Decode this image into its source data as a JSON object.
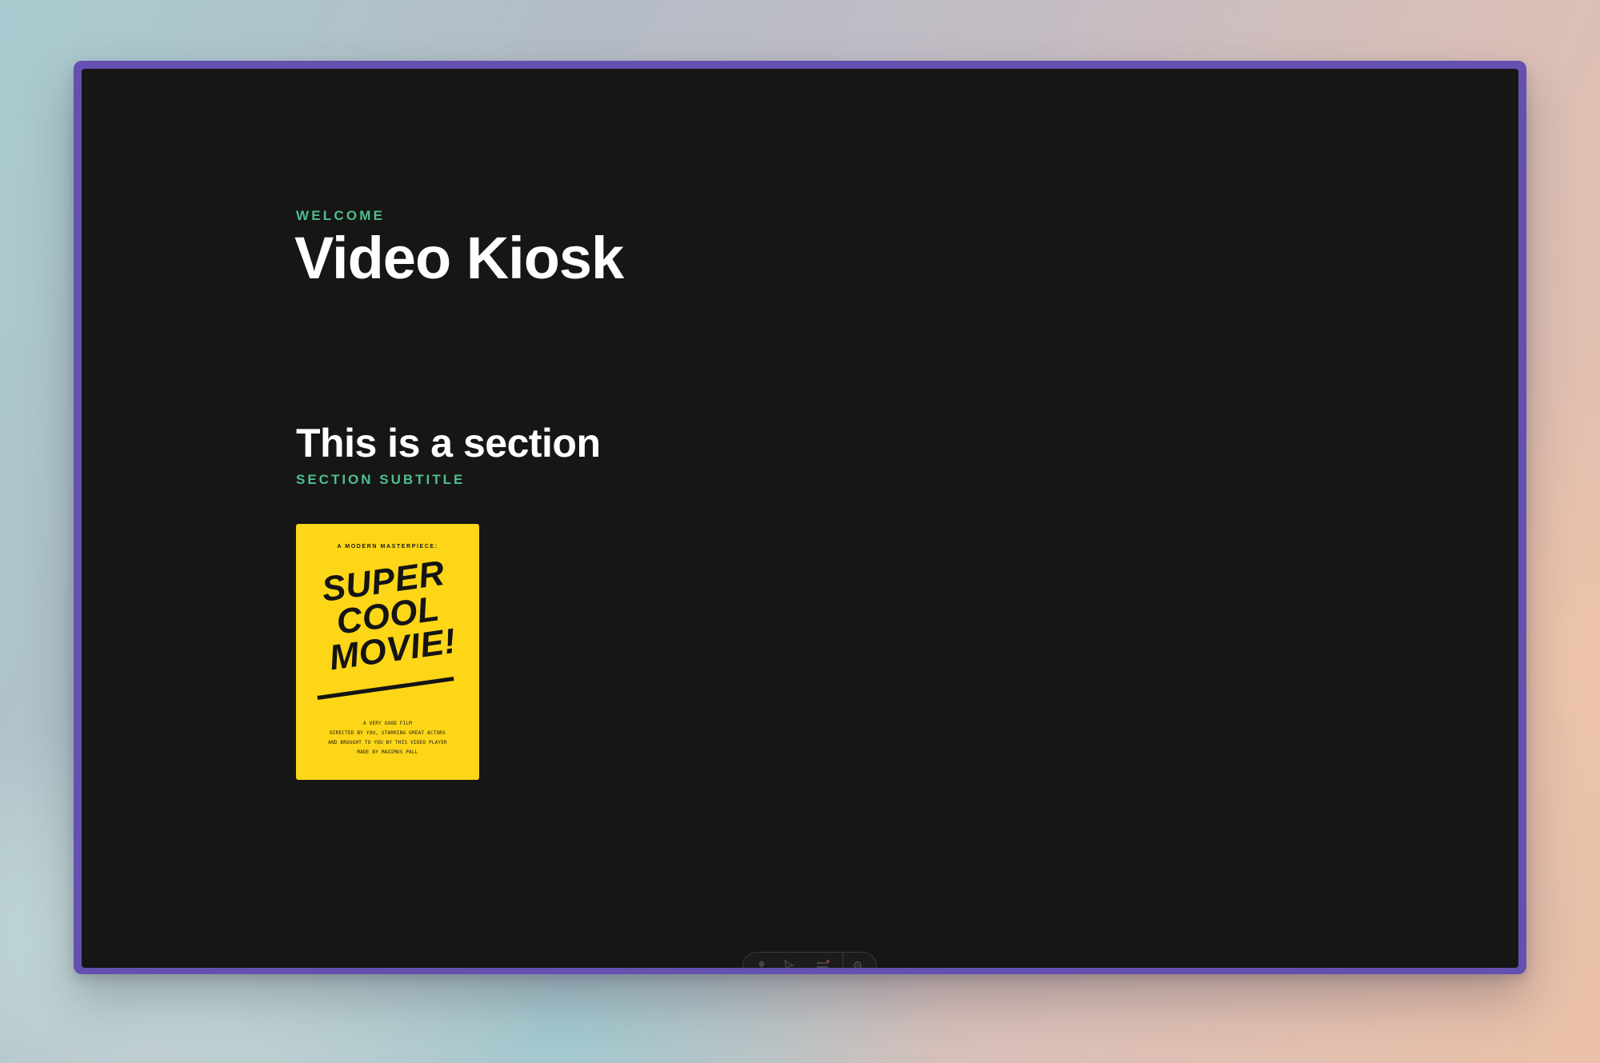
{
  "hero": {
    "eyebrow": "WELCOME",
    "title": "Video Kiosk"
  },
  "section": {
    "title": "This is a section",
    "subtitle": "SECTION SUBTITLE"
  },
  "poster": {
    "kicker": "A MODERN MASTERPIECE:",
    "headline": [
      "SUPER",
      "COOL",
      "MOVIE!"
    ],
    "credits": [
      "A VERY GOOD FILM",
      "DIRECTED BY YOU, STARRING GREAT ACTORS",
      "AND BROUGHT TO YOU BY THIS VIDEO PLAYER",
      "MADE BY MAXIMUS PALL"
    ],
    "background_color": "#fcd617"
  },
  "toolbar": {
    "icons": [
      "pin-icon",
      "cursor-icon",
      "menu-icon",
      "settings-icon"
    ]
  },
  "colors": {
    "frame": "#6450b0",
    "screen": "#161616",
    "accent": "#4fbe8c",
    "text": "#ffffff"
  }
}
